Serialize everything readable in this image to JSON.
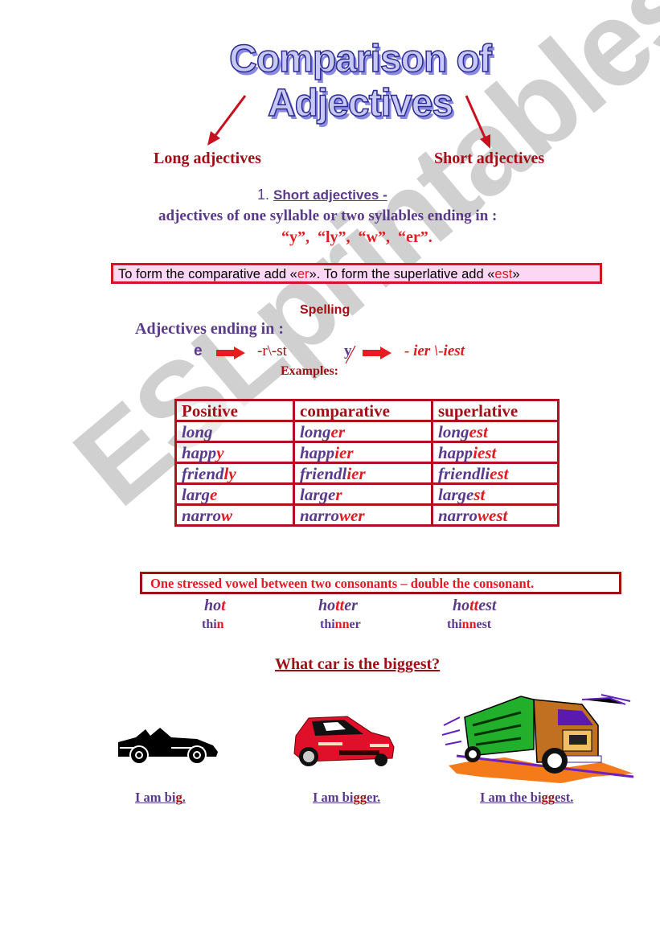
{
  "title": "Comparison of Adjectives",
  "watermark": "ESLprintables.com",
  "branches": {
    "left": "Long adjectives",
    "right": "Short adjectives"
  },
  "definition": {
    "number": "1.",
    "heading": "Short adjectives -",
    "body": "adjectives of one syllable or two syllables ending in :",
    "endings": "“y”,  “ly”,  “w”,  “er”."
  },
  "rule_box": {
    "part1": "To form the comparative  add «",
    "suffix1": "er",
    "part2": "».  To form the superlative add «",
    "suffix2": "est",
    "part3": "»"
  },
  "spelling": {
    "heading": "Spelling",
    "intro": "Adjectives ending in :",
    "rule_e": {
      "letter": "e",
      "result": "-r\\-st"
    },
    "rule_y": {
      "letter": "y",
      "result": "- ier \\-iest"
    },
    "examples_label": "Examples:"
  },
  "table": {
    "headers": [
      "Positive",
      "comparative",
      "superlative"
    ],
    "rows": [
      [
        {
          "stem": "long",
          "suffix": ""
        },
        {
          "stem": "long",
          "suffix": "er"
        },
        {
          "stem": "long",
          "suffix": "est"
        }
      ],
      [
        {
          "stem": "happ",
          "suffix": "y"
        },
        {
          "stem": "happ",
          "suffix": "ier"
        },
        {
          "stem": "happ",
          "suffix": "iest"
        }
      ],
      [
        {
          "stem": "friend",
          "suffix": "ly"
        },
        {
          "stem": "friendl",
          "suffix": "ier"
        },
        {
          "stem": "friendli",
          "suffix": "est"
        }
      ],
      [
        {
          "stem": "larg",
          "suffix": "e"
        },
        {
          "stem": "large",
          "suffix": "r"
        },
        {
          "stem": "large",
          "suffix": "st"
        }
      ],
      [
        {
          "stem": "narro",
          "suffix": "w"
        },
        {
          "stem": "narro",
          "suffix": "wer"
        },
        {
          "stem": "narro",
          "suffix": "west"
        }
      ]
    ]
  },
  "double_rule": {
    "text": "One stressed vowel between two consonants – double the  consonant.",
    "row1": [
      {
        "a": "ho",
        "b": "t",
        "c": ""
      },
      {
        "a": "ho",
        "b": "tt",
        "c": "er"
      },
      {
        "a": "ho",
        "b": "tt",
        "c": "est"
      }
    ],
    "row2": [
      {
        "a": "thi",
        "b": "n",
        "c": ""
      },
      {
        "a": "thi",
        "b": "nn",
        "c": "er"
      },
      {
        "a": "thi",
        "b": "nn",
        "c": "est"
      }
    ]
  },
  "question": "What car is the biggest?",
  "captions": [
    {
      "a": "I am bi",
      "b": "g",
      "c": "."
    },
    {
      "a": "I am bi",
      "b": "gg",
      "c": "er."
    },
    {
      "a": "I am the bi",
      "b": "gg",
      "c": "est."
    }
  ],
  "colors": {
    "purple": "#5b3a8c",
    "red": "#e01b22",
    "dark_red": "#a01016",
    "rule_box_bg": "#fbd7f3"
  }
}
